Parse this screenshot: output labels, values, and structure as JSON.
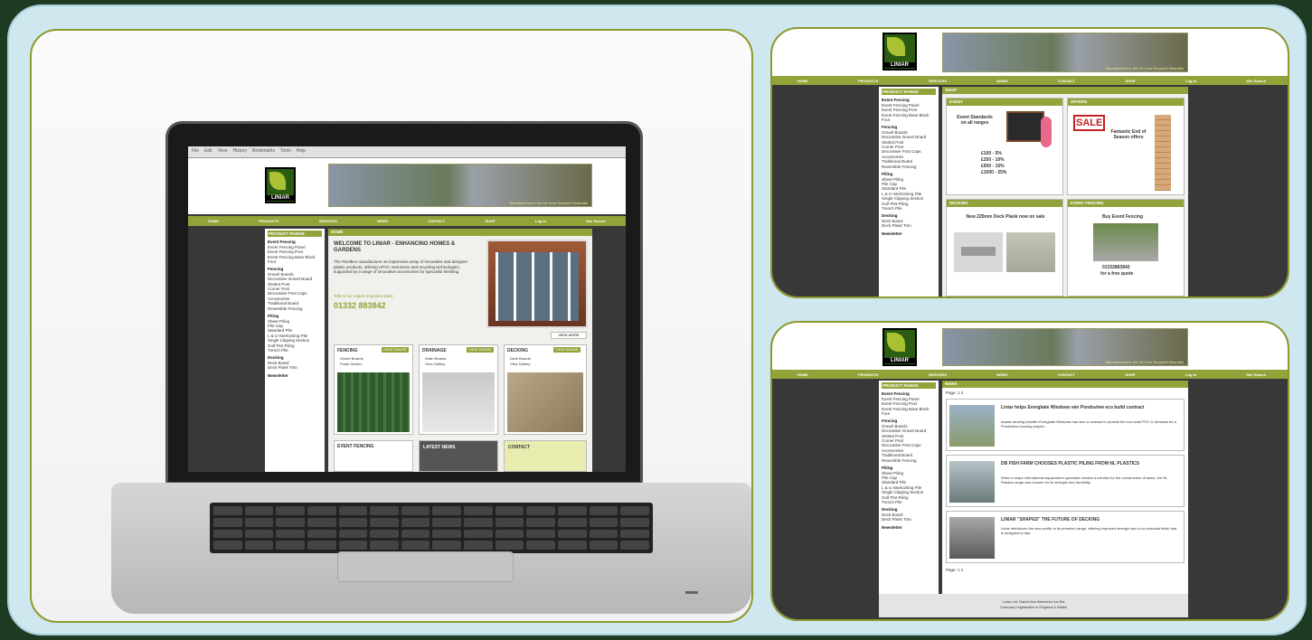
{
  "site": {
    "logo_text": "LINIAR",
    "banner_tagline": "Manufactured in the UK from Recycled Materials",
    "browser_menu": [
      "File",
      "Edit",
      "View",
      "History",
      "Bookmarks",
      "Tools",
      "Help"
    ],
    "nav": [
      "HOME",
      "PRODUCTS",
      "SERVICES",
      "NEWS",
      "CONTACT",
      "SHOP"
    ],
    "login_label": "Log In",
    "search_label": "Site Search",
    "sidebar_title": "PRODUCT RANGE",
    "sidebar_groups": [
      {
        "title": "Event Fencing",
        "items": [
          "Event Fencing Panel",
          "Event Fencing Post",
          "Event Fencing Base Block",
          "Foot"
        ]
      },
      {
        "title": "Fencing",
        "items": [
          "Gravel Boards",
          "Decorative Gravel Board",
          "Slotted Post",
          "Corner Post",
          "Decorative Post Caps",
          "Accessories",
          "Traditional Board",
          "Reversible Fencing"
        ]
      },
      {
        "title": "Piling",
        "items": [
          "Sheet Piling",
          "Pile Cap",
          "Standard Pile",
          "L & U Interlocking Pile",
          "Single Clipping Section",
          "Golf Plot Piling",
          "Trench Pile"
        ]
      },
      {
        "title": "Decking",
        "items": [
          "Deck Board",
          "Deck Plank Trim"
        ]
      },
      {
        "title": "Newsletter",
        "items": []
      }
    ],
    "home_bar": "HOME",
    "home_heading": "WELCOME TO LINIAR - ENHANCING HOMES & GARDENS",
    "home_body": "The Pixelbox manufacturer an impressive array of innovative and designer plastic products, utilising UPVC extrusions and recycling technologies, supported by a range of innovative accessories for specialist finishing.",
    "home_prompt": "Talk to our expert enquiries team:",
    "phone": "01332 883842",
    "tiles": [
      {
        "title": "FENCING",
        "button": "VIEW RANGE",
        "bullets": [
          "Gravel Boards",
          "Posts Section"
        ]
      },
      {
        "title": "DRAINAGE",
        "button": "VIEW RANGE",
        "bullets": [
          "Drain Boards",
          "View Gallery"
        ]
      },
      {
        "title": "DECKING",
        "button": "VIEW RANGE",
        "bullets": [
          "Deck Boards",
          "View Gallery"
        ]
      }
    ],
    "bottom_tiles": [
      "EVENT FENCING",
      "LATEST NEWS",
      "CONTACT"
    ],
    "shop_bar": "SHOP",
    "shop_cells": [
      {
        "head": "EVENT",
        "title": "Event Standards on all ranges",
        "prices": [
          "£100 - 5%",
          "£250 - 10%",
          "£500 - 15%",
          "£1000 - 25%"
        ]
      },
      {
        "head": "OFFERS",
        "badge": "SALE",
        "title": "Fantastic End of Season offers"
      },
      {
        "head": "DECKING",
        "title": "New 225mm Deck Plank now on sale"
      },
      {
        "head": "EVENT FENCING",
        "title": "Buy Event Fencing",
        "phone_line": "01332883842",
        "sub": "for a free quote"
      }
    ],
    "news_bar": "NEWS",
    "news_pager": "Page: 1 2",
    "news": [
      {
        "title": "Liniar helps Evergbale Windows win Pondsview eco build contract",
        "body": "Award-winning installer Evergbale Windows has won a contract to provide the eco-build PVC-U windows for a Pondsview housing project."
      },
      {
        "title": "DB FISH FARM CHOOSES PLASTIC PILING FROM NL PLASTICS",
        "body": "When a major international aquaculture specialist needed a solution for the construction of tanks, the NL Plastics range was chosen for its strength and durability."
      },
      {
        "title": "LINIAR \"SHAPES\" THE FUTURE OF DECKING",
        "body": "Liniar introduces the new profile to its premium range, offering improved strength and a co-extruded finish that is designed to last."
      }
    ],
    "footer_line1": "Liniar Ltd. Dabell Ave Blenheim Ind Est",
    "footer_line2": "Company registration in England & Wales"
  },
  "colors": {
    "accent": "#93a33a",
    "outline": "#8a9a2c",
    "dark": "#383838",
    "frame": "#cfe7ef",
    "background": "#1f3a22"
  }
}
